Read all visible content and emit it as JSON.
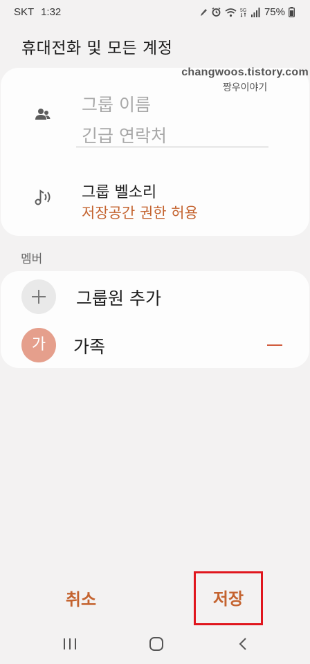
{
  "status_bar": {
    "carrier": "SKT",
    "time": "1:32",
    "battery": "75%"
  },
  "header": {
    "title": "휴대전화 및 모든 계정"
  },
  "watermark": {
    "line1": "changwoos.tistory.com",
    "line2": "짱우이야기"
  },
  "group_card": {
    "name_placeholder": "그룹 이름",
    "name_value": "긴급 연락처",
    "ringtone_label": "그룹 벨소리",
    "ringtone_sub": "저장공간 권한 허용",
    "group_icon": "people-icon",
    "ringtone_icon": "music-note-icon"
  },
  "members": {
    "section_label": "멤버",
    "add_label": "그룹원 추가",
    "items": [
      {
        "avatar_text": "가",
        "name": "가족"
      }
    ]
  },
  "footer": {
    "cancel_label": "취소",
    "save_label": "저장"
  },
  "colors": {
    "accent": "#c4632f",
    "highlight_box": "#e0161e",
    "avatar_bg": "#e59f8c",
    "background": "#f3f2f2"
  }
}
